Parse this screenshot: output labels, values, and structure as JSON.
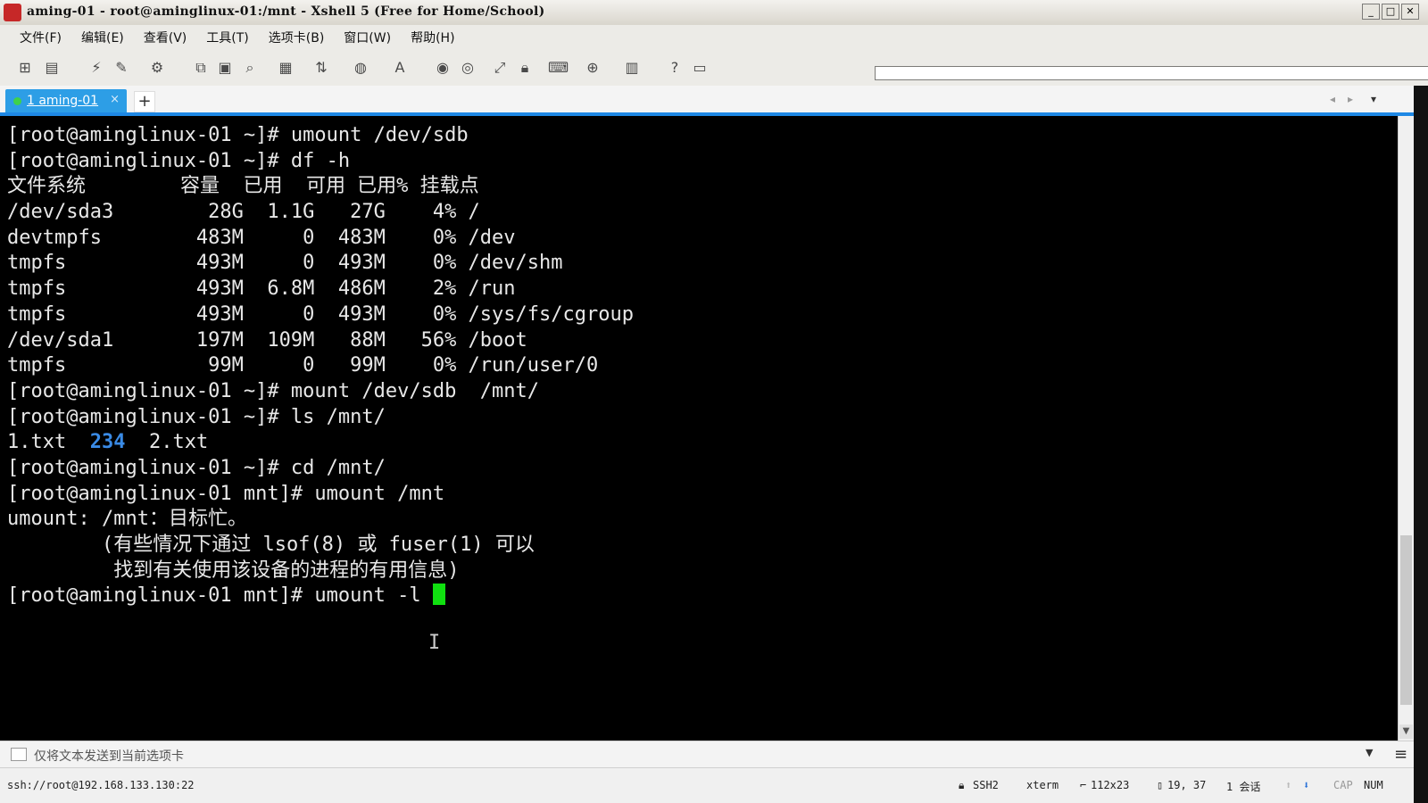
{
  "window": {
    "title": "aming-01 - root@aminglinux-01:/mnt - Xshell 5 (Free for Home/School)",
    "controls": {
      "minimize": "_",
      "maximize": "□",
      "close": "✕"
    }
  },
  "menu": {
    "items": [
      "文件(F)",
      "编辑(E)",
      "查看(V)",
      "工具(T)",
      "选项卡(B)",
      "窗口(W)",
      "帮助(H)"
    ]
  },
  "toolbar": {
    "icons": [
      "new-session-icon",
      "open-folder-icon",
      "reconnect-icon",
      "disconnect-icon",
      "properties-icon",
      "copy-icon",
      "paste-icon",
      "find-icon",
      "print-icon",
      "transfer-icon",
      "globe-icon",
      "font-icon",
      "xftp-icon",
      "xmanager-icon",
      "fullscreen-icon",
      "lock-icon",
      "keyboard-icon",
      "new-tab-icon",
      "layout-icon",
      "help-icon",
      "chat-icon"
    ]
  },
  "tabs": {
    "active": {
      "label": "1 aming-01",
      "close": "×"
    },
    "add": "+",
    "nav_left": "◂",
    "nav_right": "▸",
    "nav_menu": "▾"
  },
  "terminal": {
    "lines": [
      "[root@aminglinux-01 ~]# umount /dev/sdb",
      "[root@aminglinux-01 ~]# df -h",
      "文件系统        容量  已用  可用 已用% 挂载点",
      "/dev/sda3        28G  1.1G   27G    4% /",
      "devtmpfs        483M     0  483M    0% /dev",
      "tmpfs           493M     0  493M    0% /dev/shm",
      "tmpfs           493M  6.8M  486M    2% /run",
      "tmpfs           493M     0  493M    0% /sys/fs/cgroup",
      "/dev/sda1       197M  109M   88M   56% /boot",
      "tmpfs            99M     0   99M    0% /run/user/0",
      "[root@aminglinux-01 ~]# mount /dev/sdb  /mnt/",
      "[root@aminglinux-01 ~]# ls /mnt/"
    ],
    "ls_output": {
      "file1": "1.txt",
      "dir": "234",
      "file2": "2.txt"
    },
    "lines_after": [
      "[root@aminglinux-01 ~]# cd /mnt/",
      "[root@aminglinux-01 mnt]# umount /mnt",
      "umount: /mnt：目标忙。",
      "        (有些情况下通过 lsof(8) 或 fuser(1) 可以",
      "         找到有关使用该设备的进程的有用信息)"
    ],
    "current_prompt": "[root@aminglinux-01 mnt]# umount -l ",
    "colors": {
      "background": "#000000",
      "text": "#e8e8e8",
      "directory": "#3a8be6",
      "cursor": "#10e010"
    }
  },
  "compose": {
    "placeholder": "仅将文本发送到当前选项卡"
  },
  "status": {
    "connection": "ssh://root@192.168.133.130:22",
    "protocol": "SSH2",
    "terminal_type": "xterm",
    "size": "112x23",
    "cursor_pos": "19, 37",
    "sessions": "1 会话",
    "cap": "CAP",
    "num": "NUM"
  }
}
